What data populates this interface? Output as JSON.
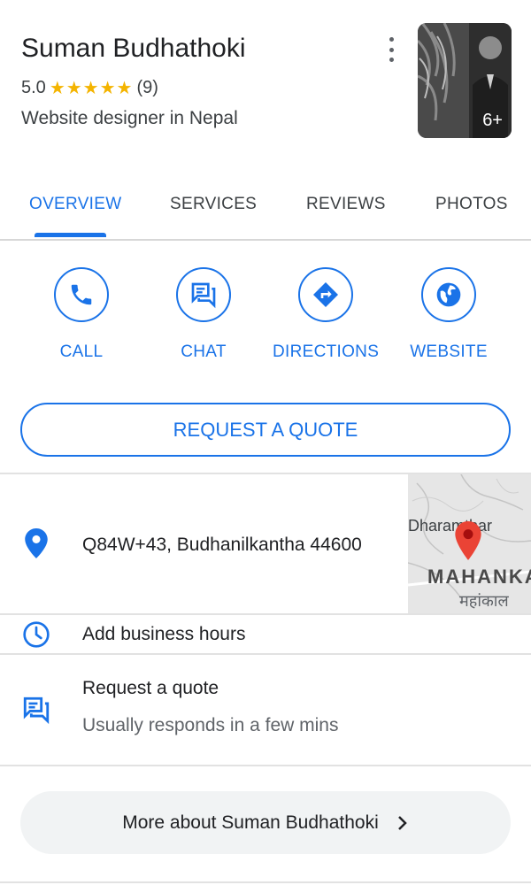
{
  "header": {
    "title": "Suman Budhathoki",
    "rating": "5.0",
    "stars": "★★★★★",
    "review_count": "(9)",
    "subtitle": "Website designer in Nepal",
    "photo_count": "6+"
  },
  "tabs": [
    "OVERVIEW",
    "SERVICES",
    "REVIEWS",
    "PHOTOS"
  ],
  "actions": {
    "call": "CALL",
    "chat": "CHAT",
    "directions": "DIRECTIONS",
    "website": "WEBSITE"
  },
  "request_quote_button": "REQUEST A QUOTE",
  "address": {
    "text": "Q84W+43, Budhanilkantha 44600",
    "map_labels": [
      "Dharamthar",
      "MAHANKA",
      "महांकाल"
    ]
  },
  "hours": {
    "text": "Add business hours"
  },
  "quote_row": {
    "title": "Request a quote",
    "subtitle": "Usually responds in a few mins"
  },
  "more_button": "More about Suman Budhathoki",
  "colors": {
    "accent": "#1a73e8",
    "star": "#f4b400",
    "map_pin": "#ea4335"
  },
  "icons": [
    "more-vert-icon",
    "phone-icon",
    "chat-icon",
    "directions-icon",
    "globe-icon",
    "location-pin-icon",
    "clock-icon",
    "chat-bubble-icon",
    "chevron-right-icon"
  ]
}
